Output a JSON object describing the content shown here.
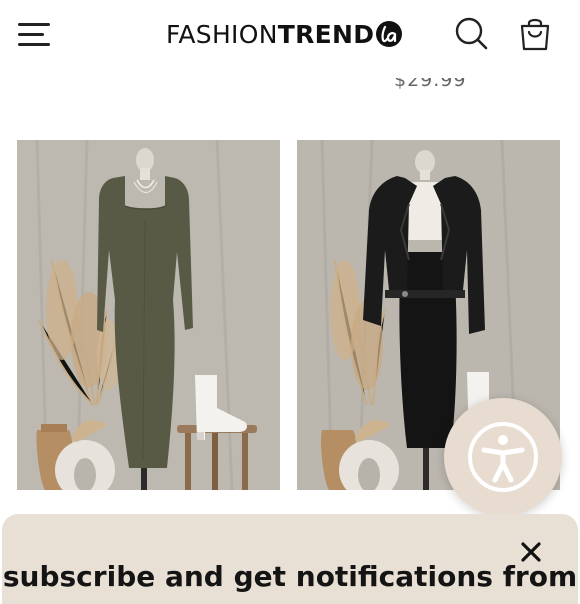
{
  "header": {
    "brand_thin": "FASHION",
    "brand_bold": "TREND",
    "brand_badge": "la",
    "menu_icon": "hamburger-menu-icon",
    "search_icon": "search-icon",
    "bag_icon": "shopping-bag-icon"
  },
  "products": {
    "previous_price": "$29.99",
    "items": [
      {
        "image": "olive long-sleeve square-neck midi dress on mannequin",
        "colors": {
          "garment": "#595a45",
          "backdrop": "#b9b5ad"
        }
      },
      {
        "image": "black faux leather jacket with white top and black midi skirt",
        "colors": {
          "garment": "#151515",
          "backdrop": "#b7b2aa"
        }
      }
    ]
  },
  "accessibility": {
    "icon": "accessibility-person-icon",
    "color": "#e7dccf"
  },
  "subscribe_sheet": {
    "text": "subscribe and get notifications from",
    "close_icon": "close-icon",
    "background": "#e9e0d5"
  }
}
